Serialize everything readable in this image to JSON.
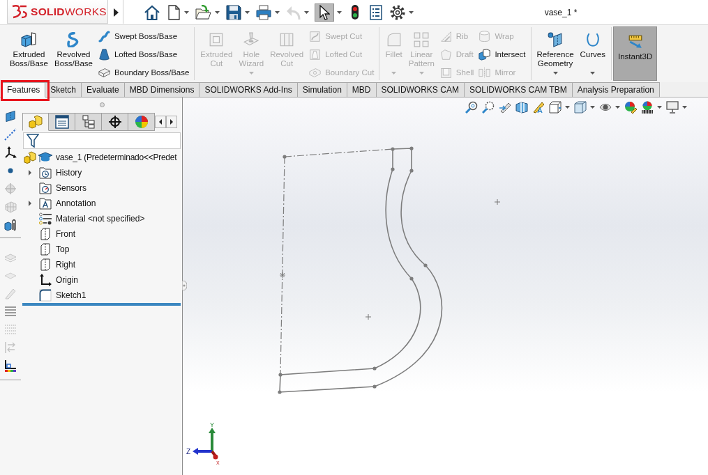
{
  "window": {
    "title": "vase_1 *"
  },
  "logo": {
    "text": "**SOLID**WORKS"
  },
  "quick_access": [
    {
      "has_menu": false,
      "disabled": false,
      "selected": false
    },
    {
      "has_menu": true,
      "disabled": false,
      "selected": false
    },
    {
      "has_menu": true,
      "disabled": false,
      "selected": false
    },
    {
      "has_menu": true,
      "disabled": false,
      "selected": false
    },
    {
      "has_menu": true,
      "disabled": false,
      "selected": false
    },
    {
      "has_menu": true,
      "disabled": true,
      "selected": false
    },
    {
      "has_menu": true,
      "disabled": false,
      "selected": true
    },
    {
      "has_menu": false,
      "disabled": false,
      "selected": false
    },
    {
      "has_menu": false,
      "disabled": false,
      "selected": false
    },
    {
      "has_menu": true,
      "disabled": false,
      "selected": false
    }
  ],
  "ribbon": {
    "groups": [
      {
        "items": [
          {
            "kind": "large",
            "label": "Extruded Boss/Base",
            "disabled": false,
            "has_menu": false,
            "on": false
          },
          {
            "kind": "large",
            "label": "Revolved Boss/Base",
            "disabled": false,
            "has_menu": false,
            "on": false
          },
          {
            "kind": "stack",
            "items": [
              {
                "label": "Swept Boss/Base",
                "disabled": false
              },
              {
                "label": "Lofted Boss/Base",
                "disabled": false
              },
              {
                "label": "Boundary Boss/Base",
                "disabled": false
              }
            ]
          }
        ]
      },
      {
        "items": [
          {
            "kind": "large",
            "label": "Extruded Cut",
            "disabled": true,
            "has_menu": false,
            "on": false
          },
          {
            "kind": "large",
            "label": "Hole Wizard",
            "disabled": true,
            "has_menu": true,
            "on": false
          },
          {
            "kind": "large",
            "label": "Revolved Cut",
            "disabled": true,
            "has_menu": false,
            "on": false
          },
          {
            "kind": "stack",
            "items": [
              {
                "label": "Swept Cut",
                "disabled": true
              },
              {
                "label": "Lofted Cut",
                "disabled": true
              },
              {
                "label": "Boundary Cut",
                "disabled": true
              }
            ]
          }
        ]
      },
      {
        "items": [
          {
            "kind": "large",
            "label": "Fillet",
            "disabled": true,
            "has_menu": true,
            "on": false
          },
          {
            "kind": "large",
            "label": "Linear Pattern",
            "disabled": true,
            "has_menu": true,
            "on": false
          },
          {
            "kind": "stack",
            "items": [
              {
                "label": "Rib",
                "disabled": true
              },
              {
                "label": "Draft",
                "disabled": true
              },
              {
                "label": "Shell",
                "disabled": true
              }
            ]
          },
          {
            "kind": "stack",
            "items": [
              {
                "label": "Wrap",
                "disabled": true
              },
              {
                "label": "Intersect",
                "disabled": false
              },
              {
                "label": "Mirror",
                "disabled": true
              }
            ]
          }
        ]
      },
      {
        "items": [
          {
            "kind": "large",
            "label": "Reference Geometry",
            "disabled": false,
            "has_menu": true,
            "on": false
          },
          {
            "kind": "large",
            "label": "Curves",
            "disabled": false,
            "has_menu": true,
            "on": false
          }
        ]
      },
      {
        "items": [
          {
            "kind": "large",
            "label": "Instant3D",
            "disabled": false,
            "has_menu": false,
            "on": true
          }
        ]
      }
    ]
  },
  "command_tabs": [
    {
      "label": "Features",
      "selected": true,
      "highlighted": true
    },
    {
      "label": "Sketch",
      "selected": false,
      "highlighted": false
    },
    {
      "label": "Evaluate",
      "selected": false,
      "highlighted": false
    },
    {
      "label": "MBD Dimensions",
      "selected": false,
      "highlighted": false
    },
    {
      "label": "SOLIDWORKS Add-Ins",
      "selected": false,
      "highlighted": false
    },
    {
      "label": "Simulation",
      "selected": false,
      "highlighted": false
    },
    {
      "label": "MBD",
      "selected": false,
      "highlighted": false
    },
    {
      "label": "SOLIDWORKS CAM",
      "selected": false,
      "highlighted": false
    },
    {
      "label": "SOLIDWORKS CAM TBM",
      "selected": false,
      "highlighted": false
    },
    {
      "label": "Analysis Preparation",
      "selected": false,
      "highlighted": false
    }
  ],
  "view_tools": [
    {
      "items": [
        {
          "disabled": false
        },
        {
          "disabled": false
        },
        {
          "disabled": false
        },
        {
          "disabled": false
        },
        {
          "disabled": true
        },
        {
          "disabled": true
        },
        {
          "disabled": false
        }
      ]
    },
    {
      "items": [
        {
          "disabled": true
        },
        {
          "disabled": true
        },
        {
          "disabled": true
        },
        {
          "disabled": false
        },
        {
          "disabled": true
        },
        {
          "disabled": true
        },
        {
          "disabled": false
        }
      ]
    }
  ],
  "manager_tabs": [
    {
      "selected": true
    },
    {
      "selected": false
    },
    {
      "selected": false
    },
    {
      "selected": false
    },
    {
      "selected": false
    }
  ],
  "feature_tree": {
    "root": {
      "label": "vase_1 (Predeterminado<<Predet",
      "children": [
        {
          "label": "History",
          "expanded": false
        },
        {
          "label": "Sensors"
        },
        {
          "label": "Annotation",
          "expanded": false
        },
        {
          "label": "Material <not specified>"
        },
        {
          "label": "Front"
        },
        {
          "label": "Top"
        },
        {
          "label": "Right"
        },
        {
          "label": "Origin"
        },
        {
          "label": "Sketch1"
        }
      ]
    }
  },
  "view_toolbar": [
    {
      "has_menu": false
    },
    {
      "has_menu": false
    },
    {
      "has_menu": false
    },
    {
      "has_menu": false
    },
    {
      "has_menu": false
    },
    {
      "has_menu": true
    },
    {
      "has_menu": true
    },
    {
      "has_menu": true
    },
    {
      "has_menu": false
    },
    {
      "has_menu": true
    },
    {
      "has_menu": true
    }
  ],
  "triad": {
    "x": "X",
    "y": "Y",
    "z": "Z"
  }
}
